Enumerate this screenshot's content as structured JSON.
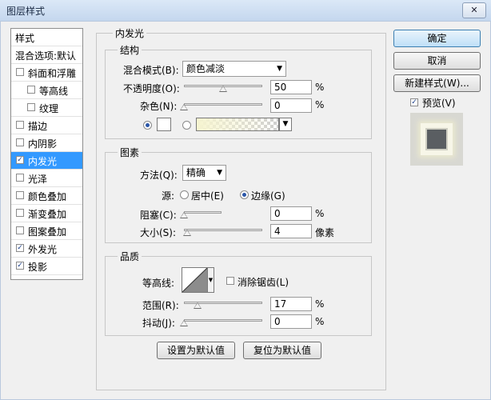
{
  "window": {
    "title": "图层样式",
    "close_glyph": "✕"
  },
  "style_list": {
    "header": "样式",
    "blend_options": "混合选项:默认",
    "items": [
      {
        "label": "斜面和浮雕",
        "checked": false
      },
      {
        "label": "等高线",
        "checked": false,
        "indent": true
      },
      {
        "label": "纹理",
        "checked": false,
        "indent": true
      },
      {
        "label": "描边",
        "checked": false
      },
      {
        "label": "内阴影",
        "checked": false
      },
      {
        "label": "内发光",
        "checked": true,
        "selected": true
      },
      {
        "label": "光泽",
        "checked": false
      },
      {
        "label": "颜色叠加",
        "checked": false
      },
      {
        "label": "渐变叠加",
        "checked": false
      },
      {
        "label": "图案叠加",
        "checked": false
      },
      {
        "label": "外发光",
        "checked": true
      },
      {
        "label": "投影",
        "checked": true
      }
    ],
    "check_glyph": "✓"
  },
  "panel_title": "内发光",
  "structure": {
    "title": "结构",
    "blend_mode_label": "混合模式(B):",
    "blend_mode_value": "颜色减淡",
    "opacity_label": "不透明度(O):",
    "opacity_value": "50",
    "opacity_unit": "%",
    "opacity_fraction": 0.5,
    "noise_label": "杂色(N):",
    "noise_value": "0",
    "noise_unit": "%",
    "noise_fraction": 0.0,
    "color_swatch": "#ffffff",
    "gradient_start": "#f6f4d0"
  },
  "elements": {
    "title": "图素",
    "method_label": "方法(Q):",
    "method_value": "精确",
    "source_label": "源:",
    "source_center": "居中(E)",
    "source_edge": "边缘(G)",
    "choke_label": "阻塞(C):",
    "choke_value": "0",
    "choke_unit": "%",
    "choke_fraction": 0.0,
    "size_label": "大小(S):",
    "size_value": "4",
    "size_unit": "像素",
    "size_fraction": 0.02
  },
  "quality": {
    "title": "品质",
    "contour_label": "等高线:",
    "antialias_label": "消除锯齿(L)",
    "range_label": "范围(R):",
    "range_value": "17",
    "range_unit": "%",
    "range_fraction": 0.17,
    "jitter_label": "抖动(J):",
    "jitter_value": "0",
    "jitter_unit": "%",
    "jitter_fraction": 0.0
  },
  "footer": {
    "set_default": "设置为默认值",
    "reset_default": "复位为默认值"
  },
  "buttons": {
    "ok": "确定",
    "cancel": "取消",
    "new_style": "新建样式(W)...",
    "preview": "预览(V)"
  },
  "colors": {
    "accent": "#3399ff",
    "window_bg": "#f0f0f0"
  }
}
